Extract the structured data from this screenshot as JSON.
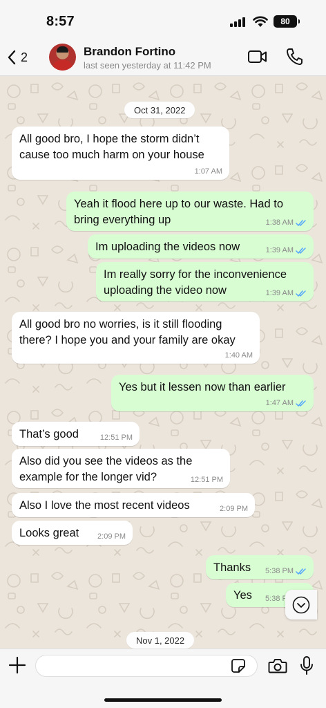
{
  "status_bar": {
    "time": "8:57",
    "battery": "80"
  },
  "header": {
    "back_count": "2",
    "contact_name": "Brandon Fortino",
    "last_seen": "last seen yesterday at 11:42 PM"
  },
  "chat": {
    "date_1": "Oct 31, 2022",
    "date_2": "Nov 1, 2022",
    "messages": [
      {
        "dir": "in",
        "text": "All good bro, I hope the storm didn’t\ncause too much harm on your house",
        "time": "1:07 AM"
      },
      {
        "dir": "out",
        "text": "Yeah it flood here up to our waste. Had to\nbring everything up",
        "time": "1:38 AM",
        "read": true
      },
      {
        "dir": "out",
        "text": "Im uploading the videos now",
        "time": "1:39 AM",
        "read": true
      },
      {
        "dir": "out",
        "text": "Im really sorry for the inconvenience\nuploading the video now",
        "time": "1:39 AM",
        "read": true
      },
      {
        "dir": "in",
        "text": "All good bro no worries, is it still flooding\nthere? I hope you and your family are okay",
        "time": "1:40 AM"
      },
      {
        "dir": "out",
        "text": "Yes but it lessen now than earlier",
        "time": "1:47 AM",
        "read": true
      },
      {
        "dir": "in",
        "text": "That’s good",
        "time": "12:51 PM"
      },
      {
        "dir": "in",
        "text": "Also did you see the videos as the\nexample for the longer vid?",
        "time": "12:51 PM"
      },
      {
        "dir": "in",
        "text": "Also I love the most recent videos",
        "time": "2:09 PM"
      },
      {
        "dir": "in",
        "text": "Looks great",
        "time": "2:09 PM"
      },
      {
        "dir": "out",
        "text": "Thanks",
        "time": "5:38 PM",
        "read": true
      },
      {
        "dir": "out",
        "text": "Yes",
        "time": "5:38 PM",
        "read": true
      }
    ]
  },
  "input": {
    "placeholder": ""
  },
  "colors": {
    "chat_background": "#ece5dc",
    "incoming_bubble": "#ffffff",
    "outgoing_bubble": "#d9fdd3",
    "read_ticks": "#53a6fc"
  },
  "icons": {
    "back": "chevron-left-icon",
    "video": "video-camera-icon",
    "call": "phone-icon",
    "scroll": "chevron-down-icon",
    "attach": "plus-icon",
    "sticker": "sticker-icon",
    "camera": "camera-icon",
    "mic": "microphone-icon"
  }
}
